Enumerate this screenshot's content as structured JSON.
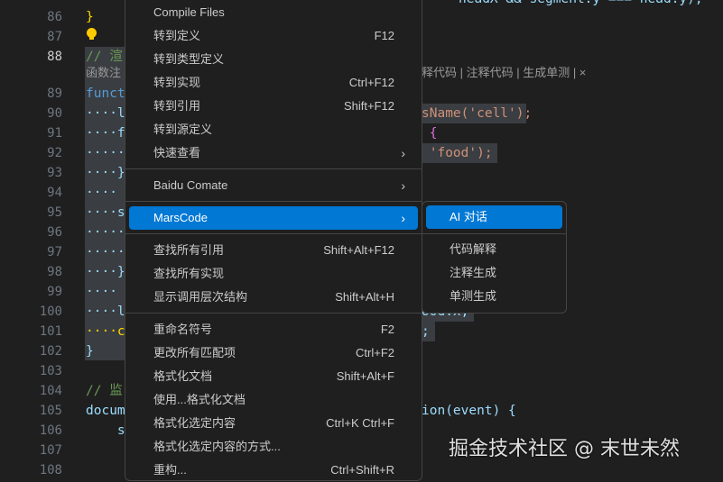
{
  "editor": {
    "lines": [
      {
        "n": "86",
        "left": "}",
        "right": ""
      },
      {
        "n": "87",
        "left": "",
        "right": ""
      },
      {
        "n": "88",
        "left": "// 渲",
        "right": ""
      },
      {
        "n": "89",
        "left": "funct",
        "right": ""
      },
      {
        "n": "90",
        "left": "····l",
        "right": "sName('cell');"
      },
      {
        "n": "91",
        "left": "····f",
        "right": " {"
      },
      {
        "n": "92",
        "left": "·······",
        "right": " 'food');"
      },
      {
        "n": "93",
        "left": "····}",
        "right": ""
      },
      {
        "n": "94",
        "left": "····",
        "right": ""
      },
      {
        "n": "95",
        "left": "····s",
        "right": ""
      },
      {
        "n": "96",
        "left": "·······",
        "right": ""
      },
      {
        "n": "97",
        "left": "·······",
        "right": ""
      },
      {
        "n": "98",
        "left": "····}",
        "right": ""
      },
      {
        "n": "99",
        "left": "····",
        "right": ""
      },
      {
        "n": "100",
        "left": "····l",
        "right": "ood.x;"
      },
      {
        "n": "101",
        "left": "····c",
        "right": ";"
      },
      {
        "n": "102",
        "left": "}",
        "right": ""
      },
      {
        "n": "103",
        "left": "",
        "right": ""
      },
      {
        "n": "104",
        "left": "// 监",
        "right": ""
      },
      {
        "n": "105",
        "left": "docum",
        "right": "ion(event) {"
      },
      {
        "n": "106",
        "left": "    s",
        "right": ""
      },
      {
        "n": "107",
        "left": "",
        "right": ""
      },
      {
        "n": "108",
        "left": "",
        "right": ""
      }
    ],
    "top_line_right": "headX && segment.y === head.y);",
    "codelens_left": "函数注",
    "codelens_right": "释代码 | 注释代码 | 生成单测 | ×"
  },
  "context_menu": {
    "groups": [
      [
        {
          "label": "Compile Files",
          "shortcut": ""
        },
        {
          "label": "转到定义",
          "shortcut": "F12"
        },
        {
          "label": "转到类型定义",
          "shortcut": ""
        },
        {
          "label": "转到实现",
          "shortcut": "Ctrl+F12"
        },
        {
          "label": "转到引用",
          "shortcut": "Shift+F12"
        },
        {
          "label": "转到源定义",
          "shortcut": ""
        },
        {
          "label": "快速查看",
          "shortcut": "",
          "submenu": true
        }
      ],
      [
        {
          "label": "Baidu Comate",
          "shortcut": "",
          "submenu": true
        }
      ],
      [
        {
          "label": "MarsCode",
          "shortcut": "",
          "submenu": true,
          "active": true
        }
      ],
      [
        {
          "label": "查找所有引用",
          "shortcut": "Shift+Alt+F12"
        },
        {
          "label": "查找所有实现",
          "shortcut": ""
        },
        {
          "label": "显示调用层次结构",
          "shortcut": "Shift+Alt+H"
        }
      ],
      [
        {
          "label": "重命名符号",
          "shortcut": "F2"
        },
        {
          "label": "更改所有匹配项",
          "shortcut": "Ctrl+F2"
        },
        {
          "label": "格式化文档",
          "shortcut": "Shift+Alt+F"
        },
        {
          "label": "使用...格式化文档",
          "shortcut": ""
        },
        {
          "label": "格式化选定内容",
          "shortcut": "Ctrl+K Ctrl+F"
        },
        {
          "label": "格式化选定内容的方式...",
          "shortcut": ""
        },
        {
          "label": "重构...",
          "shortcut": "Ctrl+Shift+R"
        }
      ]
    ]
  },
  "submenu": {
    "items": [
      {
        "label": "AI 对话",
        "active": true
      },
      {
        "label": "代码解释"
      },
      {
        "label": "注释生成"
      },
      {
        "label": "单测生成"
      }
    ]
  },
  "watermark": "掘金技术社区 @ 末世未然"
}
